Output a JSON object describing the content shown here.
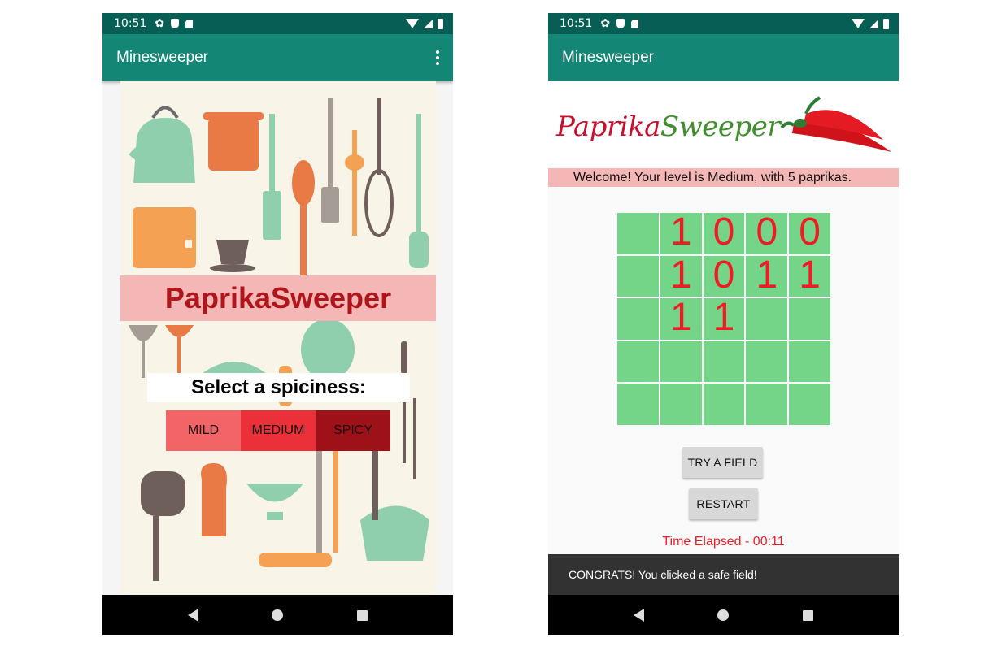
{
  "colors": {
    "status_bar": "#075e54",
    "app_bar": "#138675",
    "banner_bg": "#f5b7b5",
    "banner_text": "#b0151b",
    "mild": "#f36466",
    "medium": "#ec303a",
    "spicy": "#9e1119",
    "grid_cell": "#74d487",
    "grid_text": "#ee1c25"
  },
  "left_screen": {
    "status": {
      "time": "10:51",
      "icons": [
        "gear-icon",
        "shield-icon",
        "sd-card-icon",
        "wifi-icon",
        "signal-icon",
        "battery-icon"
      ]
    },
    "app_bar": {
      "title": "Minesweeper",
      "menu_icon": "overflow-menu-icon"
    },
    "banner": "PaprikaSweeper",
    "spice_prompt": "Select a spiciness:",
    "buttons": {
      "mild": "MILD",
      "medium": "MEDIUM",
      "spicy": "SPICY"
    },
    "background_image": "kitchen-utensils-illustration"
  },
  "right_screen": {
    "status": {
      "time": "10:51",
      "icons": [
        "gear-icon",
        "shield-icon",
        "sd-card-icon",
        "wifi-icon",
        "signal-icon",
        "battery-icon"
      ]
    },
    "app_bar": {
      "title": "Minesweeper"
    },
    "logo": {
      "part1": "Paprika",
      "part2": "Sweeper",
      "image": "red-chili-peppers"
    },
    "welcome": "Welcome! Your level is Medium, with 5 paprikas.",
    "grid": [
      [
        "",
        "1",
        "0",
        "0",
        "0"
      ],
      [
        "",
        "1",
        "0",
        "1",
        "1"
      ],
      [
        "",
        "1",
        "1",
        "",
        ""
      ],
      [
        "",
        "",
        "",
        "",
        ""
      ],
      [
        "",
        "",
        "",
        "",
        ""
      ]
    ],
    "try_button": "TRY A FIELD",
    "restart_button": "RESTART",
    "timer": "Time Elapsed - 00:11",
    "toast": "CONGRATS! You clicked a safe field!"
  },
  "nav_bar": {
    "icons": [
      "back-icon",
      "home-icon",
      "recents-icon"
    ]
  }
}
